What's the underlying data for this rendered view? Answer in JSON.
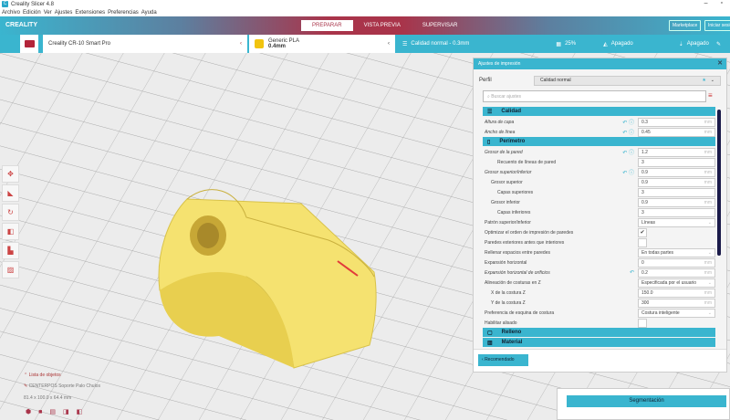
{
  "window": {
    "title": "Creality Slicer 4.8"
  },
  "menu": [
    "Archivo",
    "Edición",
    "Ver",
    "Ajustes",
    "Extensiones",
    "Preferencias",
    "Ayuda"
  ],
  "header": {
    "brand": "CREALITY",
    "stages": [
      "PREPARAR",
      "VISTA PREVIA",
      "SUPERVISAR"
    ],
    "marketplace": "Marketplace",
    "signin": "Iniciar sesión"
  },
  "toolbar": {
    "printer": "Creality CR-10 Smart Pro",
    "material_name": "Generic PLA",
    "material_nozzle": "0.4mm",
    "profile": "Calidad normal - 0.3mm",
    "infill": "25%",
    "support": "Apagado",
    "adhesion": "Apagado"
  },
  "panel": {
    "title": "Ajustes de impresión",
    "profile_label": "Perfil",
    "profile_value": "Calidad normal",
    "search_placeholder": "Buscar ajustes",
    "sections": {
      "calidad": "Calidad",
      "perimetro": "Perímetro",
      "relleno": "Relleno",
      "material": "Material"
    },
    "calidad_rows": [
      {
        "label": "Altura de capa",
        "value": "0.3",
        "unit": "mm"
      },
      {
        "label": "Ancho de línea",
        "value": "0.45",
        "unit": "mm"
      }
    ],
    "perimetro_rows": [
      {
        "label": "Grosor de la pared",
        "value": "1.2",
        "unit": "mm",
        "indent": 0
      },
      {
        "label": "Recuento de líneas de pared",
        "value": "3",
        "unit": "",
        "indent": 2
      },
      {
        "label": "Grosor superior/inferior",
        "value": "0.9",
        "unit": "mm",
        "indent": 0
      },
      {
        "label": "Grosor superior",
        "value": "0.9",
        "unit": "mm",
        "indent": 1
      },
      {
        "label": "Capas superiores",
        "value": "3",
        "unit": "",
        "indent": 2
      },
      {
        "label": "Grosor inferior",
        "value": "0.9",
        "unit": "mm",
        "indent": 1
      },
      {
        "label": "Capas inferiores",
        "value": "3",
        "unit": "",
        "indent": 2
      },
      {
        "label": "Patrón superior/inferior",
        "value": "Líneas",
        "unit": "▾",
        "indent": 0
      },
      {
        "label": "Optimizar el orden de impresión de paredes",
        "value": "✔",
        "unit": "check",
        "indent": 0
      },
      {
        "label": "Paredes exteriores antes que interiores",
        "value": "",
        "unit": "check",
        "indent": 0
      },
      {
        "label": "Rellenar espacios entre paredes",
        "value": "En todas partes",
        "unit": "▾",
        "indent": 0
      },
      {
        "label": "Expansión horizontal",
        "value": "0",
        "unit": "mm",
        "indent": 0
      },
      {
        "label": "Expansión horizontal de orificios",
        "value": "0.2",
        "unit": "mm",
        "indent": 0
      },
      {
        "label": "Alineación de costuras en Z",
        "value": "Especificada por el usuario",
        "unit": "▾",
        "indent": 0
      },
      {
        "label": "X de la costura Z",
        "value": "150.0",
        "unit": "mm",
        "indent": 1
      },
      {
        "label": "Y de la costura Z",
        "value": "300",
        "unit": "mm",
        "indent": 1
      },
      {
        "label": "Preferencia de esquina de costura",
        "value": "Costura inteligente",
        "unit": "▾",
        "indent": 0
      },
      {
        "label": "Habilitar alisado",
        "value": "",
        "unit": "check",
        "indent": 0
      }
    ],
    "recommended": "Recomendado"
  },
  "object_info": {
    "list": "Lista de objetos",
    "name": "CENTERPOS Soporte Palo Chulos",
    "dims": "81.4 x 100.0 x 64.4 mm"
  },
  "slice_button": "Segmentación"
}
